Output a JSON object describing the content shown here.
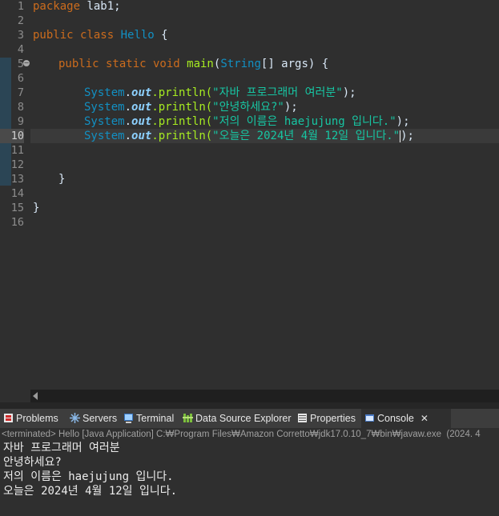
{
  "editor": {
    "line_numbers": [
      "1",
      "2",
      "3",
      "4",
      "5",
      "6",
      "7",
      "8",
      "9",
      "10",
      "11",
      "12",
      "13",
      "14",
      "15",
      "16"
    ],
    "current_line": "10",
    "lines": {
      "l1_kw": "package",
      "l1_rest": " lab1;",
      "l3_kw": "public class",
      "l3_name": " Hello",
      "l3_rest": " {",
      "l5_kw": "public static void",
      "l5_mth": " main",
      "l5_p1": "(",
      "l5_type": "String",
      "l5_p2": "[] args) {",
      "sys": "System",
      "dot": ".",
      "out": "out",
      "println": ".println(",
      "s7": "\"자바 프로그래머 여러분\"",
      "s8": "\"안녕하세요?\"",
      "s9": "\"저의 이름은 haejujung 입니다.\"",
      "s10": "\"오늘은 2024년 4월 12일 입니다.\"",
      "end": ");",
      "close_method": "}",
      "close_class": "}"
    }
  },
  "tabs": {
    "problems": "Problems",
    "servers": "Servers",
    "terminal": "Terminal",
    "datasource": "Data Source Explorer",
    "properties": "Properties",
    "console": "Console",
    "close": "✕"
  },
  "console": {
    "status": "<terminated> Hello [Java Application] C:₩Program Files₩Amazon Corretto₩jdk17.0.10_7₩bin₩javaw.exe  (2024. 4",
    "output": [
      "자바 프로그래머 여러분",
      "안녕하세요?",
      "저의 이름은 haejujung 입니다.",
      "오늘은 2024년 4월 12일 입니다."
    ]
  },
  "colors": {
    "background": "#2f2f2f",
    "keyword": "#cc6c1d",
    "class": "#1290c3",
    "method": "#a7ec21",
    "string": "#17c6a3",
    "field": "#8dd1ff"
  }
}
